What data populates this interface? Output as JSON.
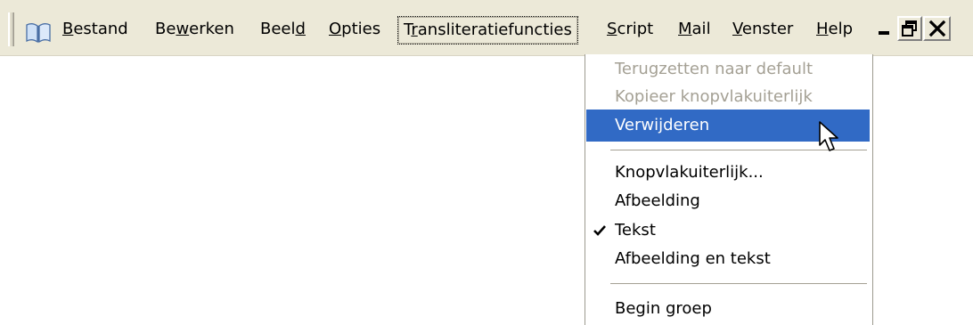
{
  "menubar": {
    "items": [
      {
        "label": "Bestand",
        "mnemonic": "B",
        "rest": "estand"
      },
      {
        "label": "Bewerken",
        "pre": "Be",
        "mnemonic": "w",
        "rest": "erken"
      },
      {
        "label": "Beeld",
        "pre": "Beel",
        "mnemonic": "d",
        "rest": ""
      },
      {
        "label": "Opties",
        "mnemonic": "O",
        "rest": "pties"
      },
      {
        "label": "Transliteratiefuncties",
        "pre": "T",
        "mnemonic": "r",
        "rest": "ansliteratiefuncties"
      },
      {
        "label": "Script",
        "mnemonic": "S",
        "rest": "cript"
      },
      {
        "label": "Mail",
        "mnemonic": "M",
        "rest": "ail"
      },
      {
        "label": "Venster",
        "mnemonic": "V",
        "rest": "enster"
      },
      {
        "label": "Help",
        "mnemonic": "H",
        "rest": "elp"
      }
    ],
    "app_icon": "book-icon",
    "window_buttons": [
      "minimize-icon",
      "restore-icon",
      "close-icon"
    ]
  },
  "dropdown": {
    "items": [
      {
        "label": "Terugzetten naar default",
        "state": "disabled"
      },
      {
        "label": "Kopieer knopvlakuiterlijk",
        "state": "disabled"
      },
      {
        "label": "Verwijderen",
        "state": "highlighted"
      },
      {
        "label": "Knopvlakuiterlijk...",
        "state": "normal"
      },
      {
        "label": "Afbeelding",
        "state": "normal"
      },
      {
        "label": "Tekst",
        "state": "checked"
      },
      {
        "label": "Afbeelding en tekst",
        "state": "normal"
      },
      {
        "label": "Begin groep",
        "state": "normal"
      }
    ]
  },
  "colors": {
    "menubar_bg": "#ece9d8",
    "highlight": "#316ac5",
    "disabled_text": "#a4a094"
  }
}
